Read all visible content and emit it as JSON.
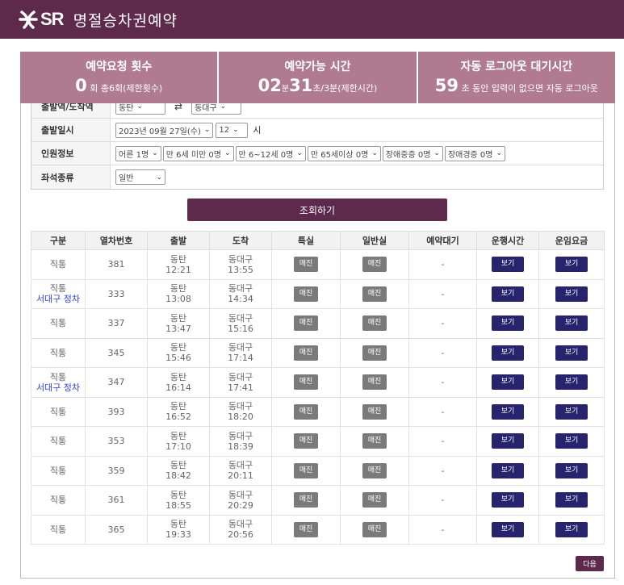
{
  "header": {
    "logo_text": "SR",
    "title": "명절승차권예약"
  },
  "info": {
    "requests": {
      "title": "예약요청 횟수",
      "count": "0",
      "unit": "회",
      "detail": "총6회(제한횟수)"
    },
    "time": {
      "title": "예약가능 시간",
      "minutes": "02",
      "min_unit": "분",
      "seconds": "31",
      "detail": "초/3분(제한시간)"
    },
    "logout": {
      "title": "자동 로그아웃 대기시간",
      "seconds": "59",
      "detail": "초 동안 입력이 없으면 자동 로그아웃"
    }
  },
  "form": {
    "rows": {
      "station": {
        "label": "출발역/도착역",
        "dep": "동탄",
        "arr": "동대구"
      },
      "datetime": {
        "label": "출발일시",
        "date": "2023년 09월 27일(수)",
        "hour": "12",
        "unit": "시"
      },
      "passengers": {
        "label": "인원정보",
        "options": [
          "어른 1명",
          "만 6세 미만 0명",
          "만 6~12세 0명",
          "만 65세이상 0명",
          "장애중증 0명",
          "장애경증 0명"
        ]
      },
      "seat": {
        "label": "좌석종류",
        "value": "일반"
      }
    }
  },
  "search_label": "조회하기",
  "table": {
    "headers": [
      "구분",
      "열차번호",
      "출발",
      "도착",
      "특실",
      "일반실",
      "예약대기",
      "운행시간",
      "운임요금"
    ],
    "rows": [
      {
        "type": "직통",
        "via": "",
        "no": "381",
        "dep_st": "동탄",
        "dep_t": "12:21",
        "arr_st": "동대구",
        "arr_t": "13:55",
        "special": "매진",
        "general": "매진",
        "wait": "-",
        "time_btn": "보기",
        "fare_btn": "보기"
      },
      {
        "type": "직통",
        "via": "서대구 정차",
        "no": "333",
        "dep_st": "동탄",
        "dep_t": "13:08",
        "arr_st": "동대구",
        "arr_t": "14:34",
        "special": "매진",
        "general": "매진",
        "wait": "-",
        "time_btn": "보기",
        "fare_btn": "보기"
      },
      {
        "type": "직통",
        "via": "",
        "no": "337",
        "dep_st": "동탄",
        "dep_t": "13:47",
        "arr_st": "동대구",
        "arr_t": "15:16",
        "special": "매진",
        "general": "매진",
        "wait": "-",
        "time_btn": "보기",
        "fare_btn": "보기"
      },
      {
        "type": "직통",
        "via": "",
        "no": "345",
        "dep_st": "동탄",
        "dep_t": "15:46",
        "arr_st": "동대구",
        "arr_t": "17:14",
        "special": "매진",
        "general": "매진",
        "wait": "-",
        "time_btn": "보기",
        "fare_btn": "보기"
      },
      {
        "type": "직통",
        "via": "서대구 정차",
        "no": "347",
        "dep_st": "동탄",
        "dep_t": "16:14",
        "arr_st": "동대구",
        "arr_t": "17:41",
        "special": "매진",
        "general": "매진",
        "wait": "-",
        "time_btn": "보기",
        "fare_btn": "보기"
      },
      {
        "type": "직통",
        "via": "",
        "no": "393",
        "dep_st": "동탄",
        "dep_t": "16:52",
        "arr_st": "동대구",
        "arr_t": "18:20",
        "special": "매진",
        "general": "매진",
        "wait": "-",
        "time_btn": "보기",
        "fare_btn": "보기"
      },
      {
        "type": "직통",
        "via": "",
        "no": "353",
        "dep_st": "동탄",
        "dep_t": "17:10",
        "arr_st": "동대구",
        "arr_t": "18:39",
        "special": "매진",
        "general": "매진",
        "wait": "-",
        "time_btn": "보기",
        "fare_btn": "보기"
      },
      {
        "type": "직통",
        "via": "",
        "no": "359",
        "dep_st": "동탄",
        "dep_t": "18:42",
        "arr_st": "동대구",
        "arr_t": "20:11",
        "special": "매진",
        "general": "매진",
        "wait": "-",
        "time_btn": "보기",
        "fare_btn": "보기"
      },
      {
        "type": "직통",
        "via": "",
        "no": "361",
        "dep_st": "동탄",
        "dep_t": "18:55",
        "arr_st": "동대구",
        "arr_t": "20:29",
        "special": "매진",
        "general": "매진",
        "wait": "-",
        "time_btn": "보기",
        "fare_btn": "보기"
      },
      {
        "type": "직통",
        "via": "",
        "no": "365",
        "dep_st": "동탄",
        "dep_t": "19:33",
        "arr_st": "동대구",
        "arr_t": "20:56",
        "special": "매진",
        "general": "매진",
        "wait": "-",
        "time_btn": "보기",
        "fare_btn": "보기"
      }
    ]
  },
  "next_label": "다음",
  "colors": {
    "brand": "#5d2a4c",
    "info_bg": "#b07b8e",
    "button_dark": "#27246d",
    "sold_out": "#7a7a7a",
    "via_text": "#2a3fd8"
  },
  "icons": {
    "logo": "sr-logo-icon",
    "swap": "swap-arrows-icon",
    "dropdown": "chevron-down-icon"
  }
}
